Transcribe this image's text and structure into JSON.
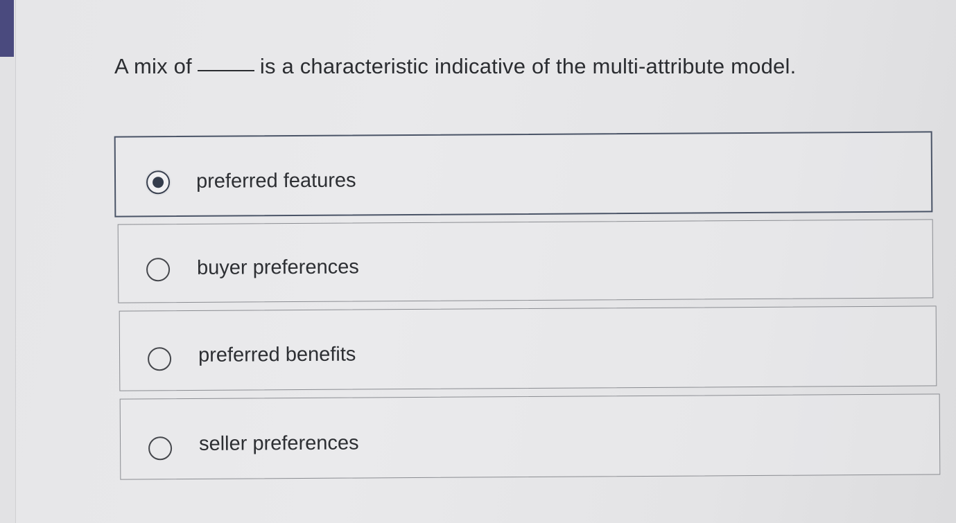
{
  "question": {
    "text_before": "A mix of",
    "text_after": "is a characteristic indicative of the multi-attribute model."
  },
  "options": [
    {
      "label": "preferred features",
      "selected": true
    },
    {
      "label": "buyer preferences",
      "selected": false
    },
    {
      "label": "preferred benefits",
      "selected": false
    },
    {
      "label": "seller preferences",
      "selected": false
    }
  ],
  "colors": {
    "accent": "#4a4a7e",
    "radio_fill": "#343c4c",
    "text": "#2d2f33"
  }
}
